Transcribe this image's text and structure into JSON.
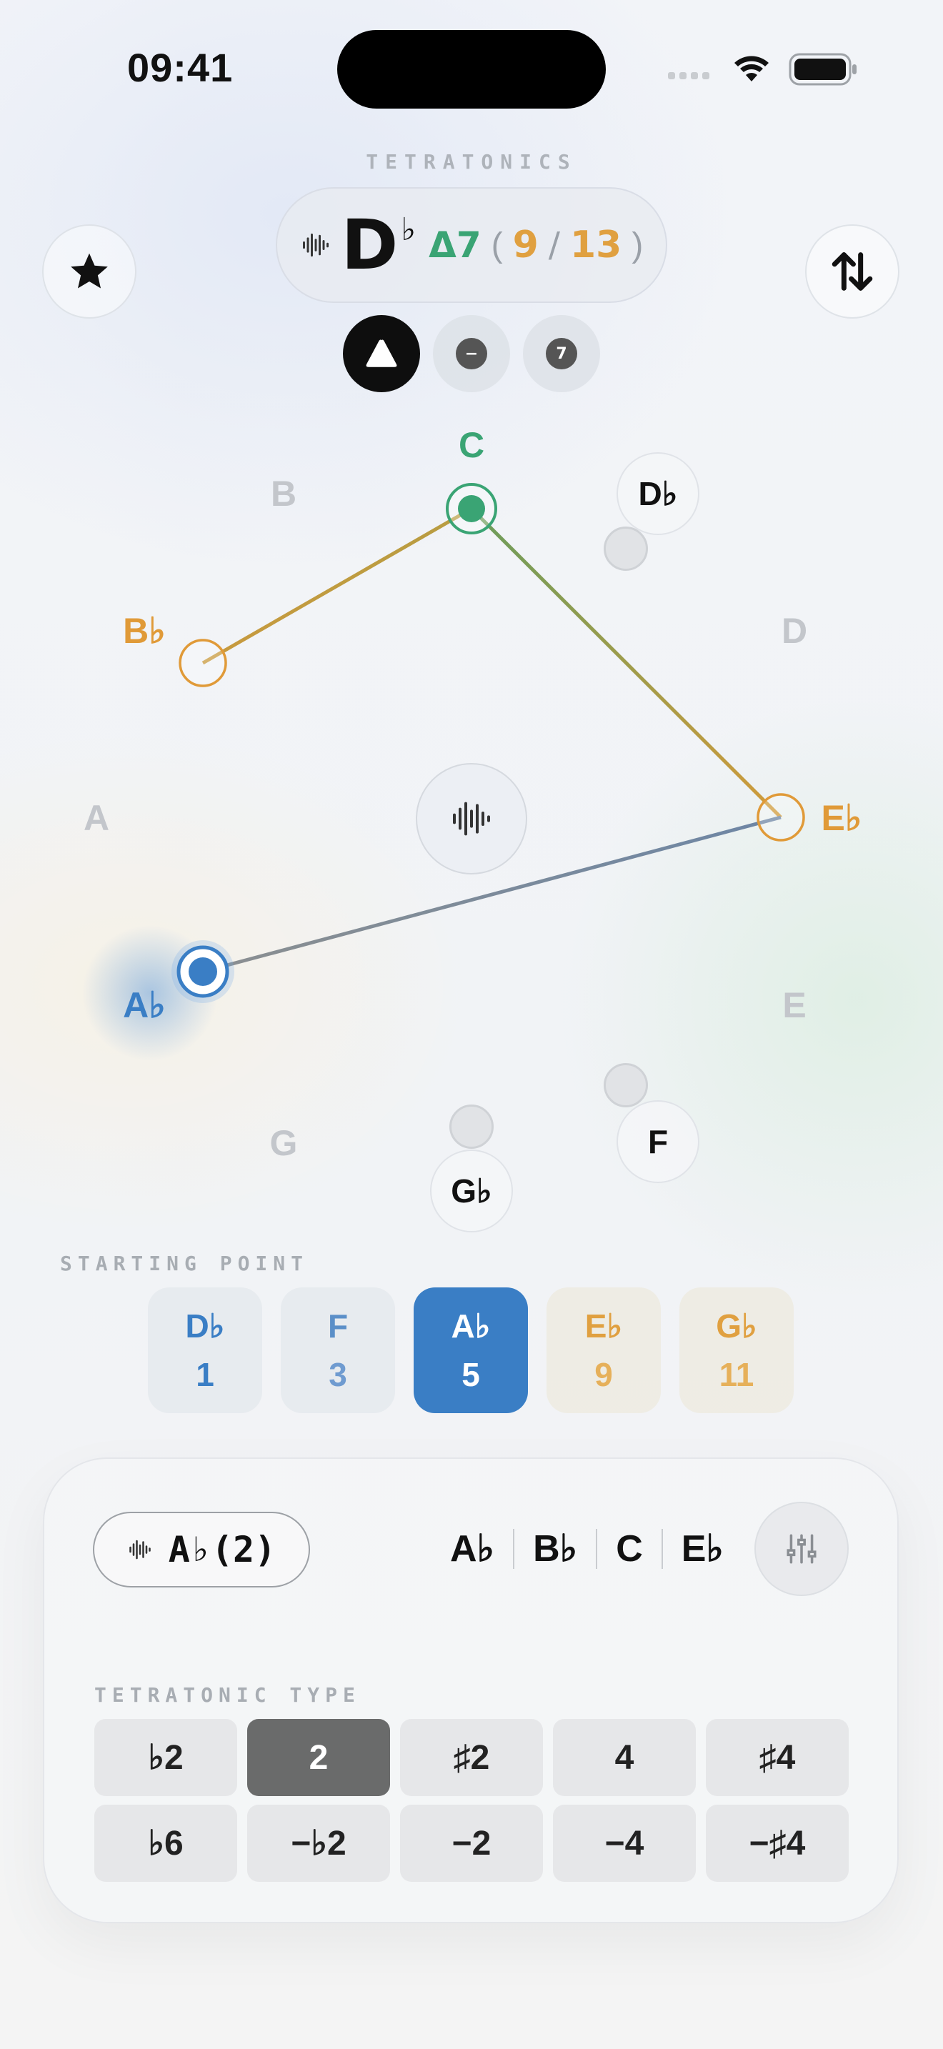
{
  "status_bar": {
    "time": "09:41"
  },
  "header": {
    "app_name": "TETRATONICS",
    "chord": {
      "root": "D",
      "accidental": "♭",
      "quality": "Δ7",
      "open_paren": "(",
      "current": "9",
      "slash": "/",
      "total": "13",
      "close_paren": ")"
    },
    "favorite_icon": "star-icon",
    "swap_icon": "arrows-up-down-icon"
  },
  "modes": [
    {
      "name": "triangle",
      "active": true
    },
    {
      "name": "minus",
      "active": false,
      "glyph": "−"
    },
    {
      "name": "seven",
      "active": false,
      "glyph": "7"
    }
  ],
  "circle": {
    "notes": [
      {
        "id": "C",
        "label": "C",
        "color": "#3aa474"
      },
      {
        "id": "Db",
        "label": "D♭",
        "color": "#111111"
      },
      {
        "id": "D",
        "label": "D",
        "color": "#c3c6cb"
      },
      {
        "id": "Eb",
        "label": "E♭",
        "color": "#e09a38"
      },
      {
        "id": "E",
        "label": "E",
        "color": "#c3c6cb"
      },
      {
        "id": "F",
        "label": "F",
        "color": "#111111"
      },
      {
        "id": "Gb",
        "label": "G♭",
        "color": "#111111"
      },
      {
        "id": "G",
        "label": "G",
        "color": "#c3c6cb"
      },
      {
        "id": "Ab",
        "label": "A♭",
        "color": "#3a7ec5"
      },
      {
        "id": "A",
        "label": "A",
        "color": "#c3c6cb"
      },
      {
        "id": "Bb",
        "label": "B♭",
        "color": "#e09a38"
      },
      {
        "id": "B",
        "label": "B",
        "color": "#c3c6cb"
      }
    ],
    "polygon_notes": [
      "Ab",
      "Bb",
      "C",
      "Eb"
    ],
    "play_icon": "waveform-icon"
  },
  "starting_point": {
    "label": "STARTING POINT",
    "options": [
      {
        "note": "D♭",
        "degree": "1",
        "color": "#3a7ec5",
        "selected": false
      },
      {
        "note": "F",
        "degree": "3",
        "color": "#5b8fc8",
        "selected": false
      },
      {
        "note": "A♭",
        "degree": "5",
        "color": "#ffffff",
        "selected": true
      },
      {
        "note": "E♭",
        "degree": "9",
        "color": "#e0a040",
        "selected": false
      },
      {
        "note": "G♭",
        "degree": "11",
        "color": "#e0a040",
        "selected": false
      }
    ]
  },
  "panel": {
    "root_label": "A♭(2)",
    "scale_notes": [
      "A♭",
      "B♭",
      "C",
      "E♭"
    ],
    "settings_icon": "sliders-icon",
    "type_label": "TETRATONIC TYPE",
    "types_row1": [
      {
        "label": "♭2",
        "active": false
      },
      {
        "label": "2",
        "active": true
      },
      {
        "label": "♯2",
        "active": false
      },
      {
        "label": "4",
        "active": false
      },
      {
        "label": "♯4",
        "active": false
      }
    ],
    "types_row2": [
      {
        "label": "♭6",
        "active": false
      },
      {
        "label": "−♭2",
        "active": false
      },
      {
        "label": "−2",
        "active": false
      },
      {
        "label": "−4",
        "active": false
      },
      {
        "label": "−♯4",
        "active": false
      }
    ]
  }
}
